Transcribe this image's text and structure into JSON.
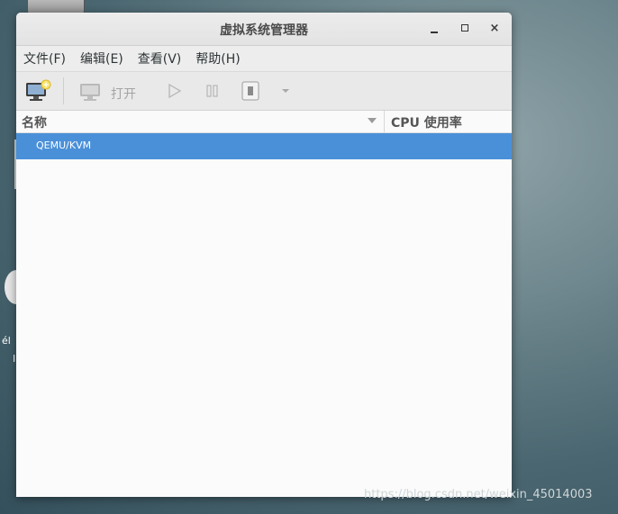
{
  "window": {
    "title": "虚拟系统管理器",
    "controls": {
      "minimize": "minimize-icon",
      "maximize": "maximize-icon",
      "close": "×"
    }
  },
  "menubar": {
    "items": [
      "文件(F)",
      "编辑(E)",
      "查看(V)",
      "帮助(H)"
    ]
  },
  "toolbar": {
    "new_vm_icon": "new-vm-icon",
    "open_icon": "monitor-icon",
    "open_label": "打开",
    "run_icon": "play-icon",
    "pause_icon": "pause-icon",
    "shutdown_icon": "shutdown-icon",
    "shutdown_menu_icon": "dropdown-arrow-icon"
  },
  "list": {
    "columns": [
      "名称",
      "CPU 使用率"
    ],
    "rows": [
      {
        "name": "QEMU/KVM",
        "selected": true
      }
    ]
  },
  "colors": {
    "selection": "#4a90d9",
    "window_bg": "#fbfbfb",
    "titlebar": "#e8e8e8"
  },
  "desktop": {
    "watermark": "https://blog.csdn.net/weixin_45014003",
    "icon_label_fragment": "él"
  }
}
